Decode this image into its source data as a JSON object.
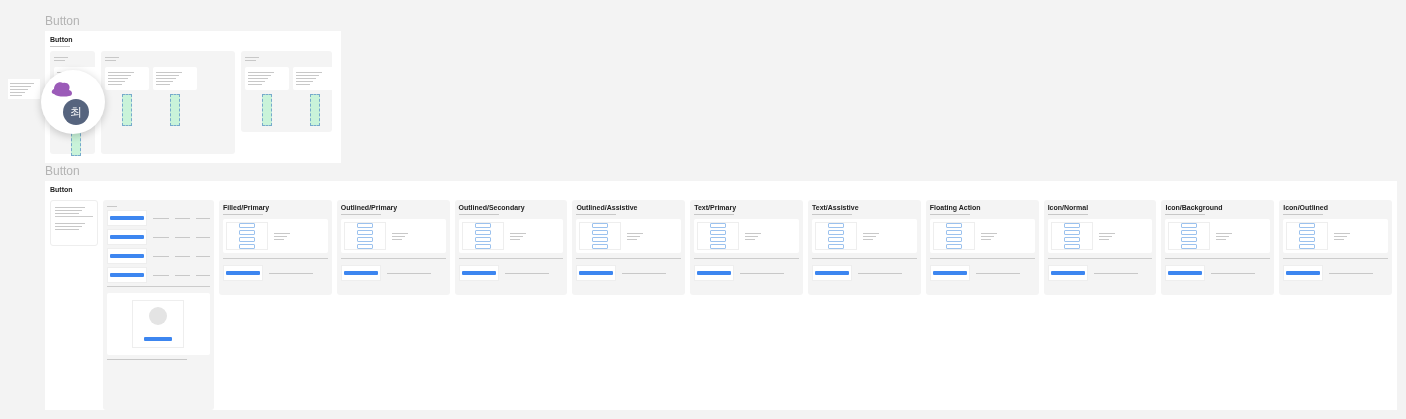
{
  "sections": [
    {
      "label": "Button",
      "frame": {
        "title": "Button",
        "kind": "overview",
        "avatar": {
          "initial": "최"
        }
      }
    },
    {
      "label": "Button",
      "frame": {
        "title": "Button",
        "kind": "guide",
        "cards": [
          {
            "kind": "note"
          },
          {
            "kind": "guide"
          },
          {
            "kind": "variant",
            "title": "Filled/Primary"
          },
          {
            "kind": "variant",
            "title": "Outlined/Primary"
          },
          {
            "kind": "variant",
            "title": "Outlined/Secondary"
          },
          {
            "kind": "variant",
            "title": "Outlined/Assistive"
          },
          {
            "kind": "variant",
            "title": "Text/Primary"
          },
          {
            "kind": "variant",
            "title": "Text/Assistive"
          },
          {
            "kind": "variant",
            "title": "Floating Action"
          },
          {
            "kind": "variant",
            "title": "Icon/Normal"
          },
          {
            "kind": "variant",
            "title": "Icon/Background"
          },
          {
            "kind": "variant",
            "title": "Icon/Outlined"
          }
        ]
      }
    }
  ]
}
